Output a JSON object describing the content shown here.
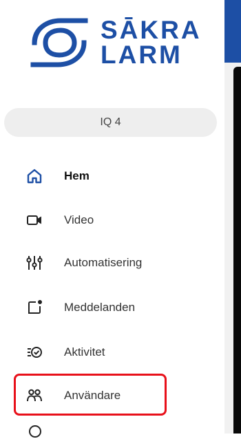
{
  "brand": {
    "line1": "SĀKRA",
    "line2": "LARM",
    "color": "#1d4fa5"
  },
  "system_selector": {
    "label": "IQ 4"
  },
  "nav": {
    "items": [
      {
        "label": "Hem",
        "icon": "home-icon",
        "active": true
      },
      {
        "label": "Video",
        "icon": "video-camera-icon",
        "active": false
      },
      {
        "label": "Automatisering",
        "icon": "sliders-icon",
        "active": false
      },
      {
        "label": "Meddelanden",
        "icon": "notification-icon",
        "active": false
      },
      {
        "label": "Aktivitet",
        "icon": "activity-list-icon",
        "active": false
      },
      {
        "label": "Användare",
        "icon": "users-icon",
        "active": false
      }
    ]
  },
  "annotation": {
    "highlight_color": "#e8101a",
    "highlighted_item": "Användare"
  }
}
